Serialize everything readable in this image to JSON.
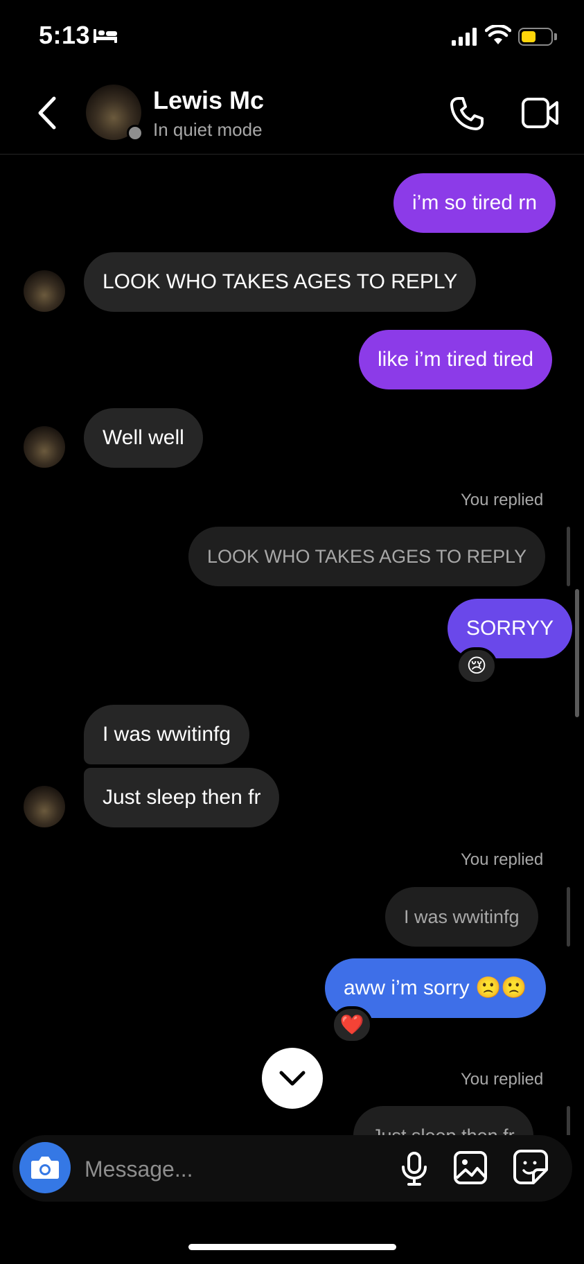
{
  "status_bar": {
    "time": "5:13"
  },
  "header": {
    "name": "Lewis Mc",
    "status": "In quiet mode"
  },
  "messages": {
    "m1": "i’m so tired rn",
    "m2": "LOOK WHO TAKES AGES TO REPLY",
    "m3": "like i’m tired tired",
    "m4": "Well well",
    "reply1_label": "You replied",
    "reply1_quote": "LOOK WHO TAKES AGES TO REPLY",
    "m5": "SORRYY",
    "m5_reaction": "😢",
    "m6": "I was wwitinfg",
    "m7": "Just sleep then fr",
    "reply2_label": "You replied",
    "reply2_quote": "I was wwitinfg",
    "m8": "aww i’m sorry 🙁🙁",
    "m8_reaction": "❤️",
    "reply3_label": "You replied",
    "reply3_quote": "Just sleep then fr"
  },
  "composer": {
    "placeholder": "Message..."
  },
  "colors": {
    "outgoing_purple": "#8c3be8",
    "outgoing_violet": "#6a48ea",
    "outgoing_blue": "#3e6fe8",
    "incoming": "#262626",
    "camera_button": "#3578e5"
  }
}
